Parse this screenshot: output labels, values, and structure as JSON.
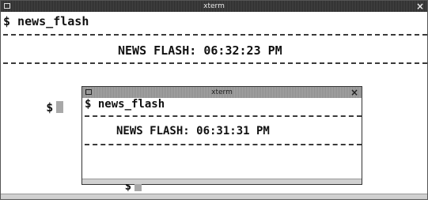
{
  "outer": {
    "title": "xterm",
    "prompt_line": "$ news_flash",
    "flash_line": "NEWS FLASH: 06:32:23 PM",
    "prompt": "$"
  },
  "inner": {
    "title": "xterm",
    "prompt_line": "$ news_flash",
    "flash_line": "NEWS FLASH: 06:31:31 PM",
    "prompt": "$"
  }
}
